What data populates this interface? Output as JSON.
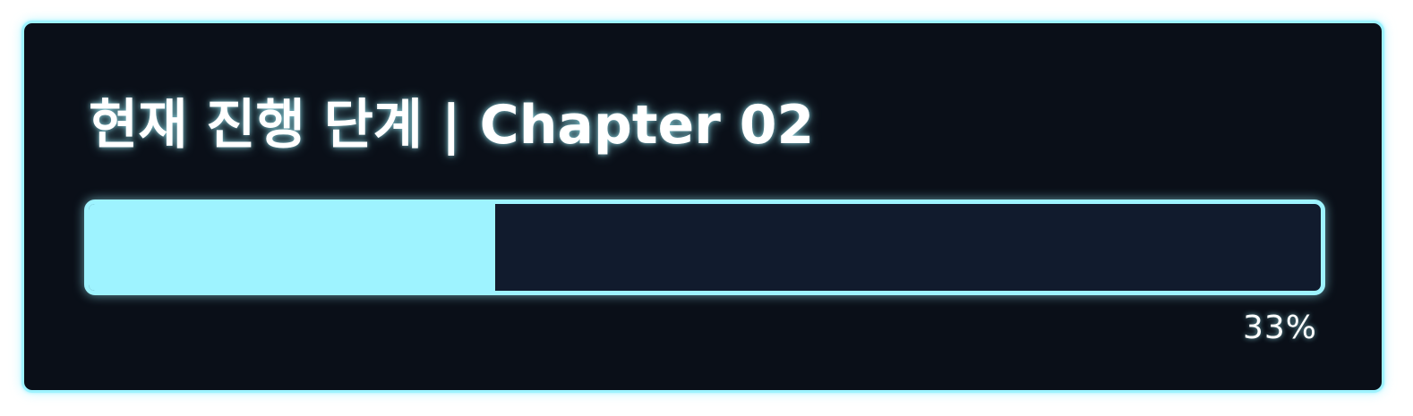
{
  "progress_panel": {
    "title": "현재 진행 단계 | Chapter 02",
    "progress_fraction": 0.33,
    "percent_label": "33%"
  },
  "colors": {
    "accent": "#9ef3ff",
    "panel_background": "#0a0f18",
    "track_background": "#111b2d",
    "text": "#ffffff"
  }
}
